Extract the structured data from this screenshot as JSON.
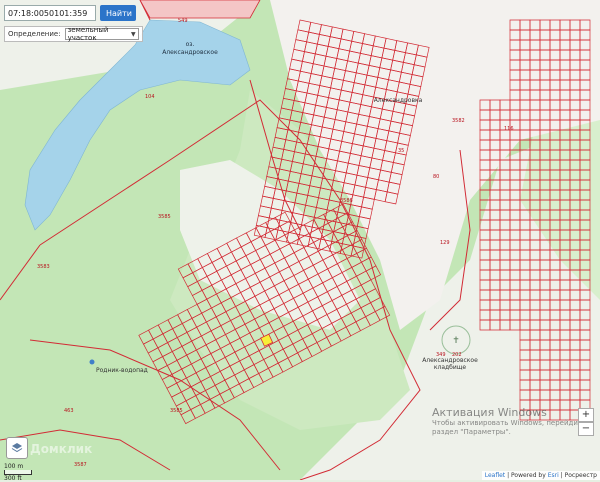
{
  "search": {
    "value": "07:18:0050101:359",
    "button_label": "Найти"
  },
  "definition": {
    "label": "Определение:",
    "selected": "земельный участок"
  },
  "map": {
    "lake_name_line1": "оз.",
    "lake_name_line2": "Александровское",
    "pump_label": "Родник-водопад",
    "cemetery_label_line1": "Александровское",
    "cemetery_label_line2": "кладбище",
    "village_label": "Александровка",
    "parcel_labels": [
      "549",
      "104",
      "3585",
      "3583",
      "3586",
      "3582",
      "463",
      "3587",
      "3585",
      "349",
      "202",
      "35",
      "80",
      "129",
      "116"
    ],
    "watermark": "Домклик"
  },
  "scale": {
    "top": "100 m",
    "bottom": "300 ft"
  },
  "attribution": {
    "leaflet": "Leaflet",
    "powered": "Powered by",
    "esri": "Esri",
    "rosreestr": "Росреестр"
  },
  "windows_activation": {
    "title": "Активация Windows",
    "line1": "Чтобы активировать Windows, перейдите в",
    "line2": "раздел \"Параметры\"."
  },
  "colors": {
    "lake": "#a5d3ea",
    "forest": "#bde3b0",
    "parcel": "#d22b35",
    "button": "#2b74c9"
  }
}
